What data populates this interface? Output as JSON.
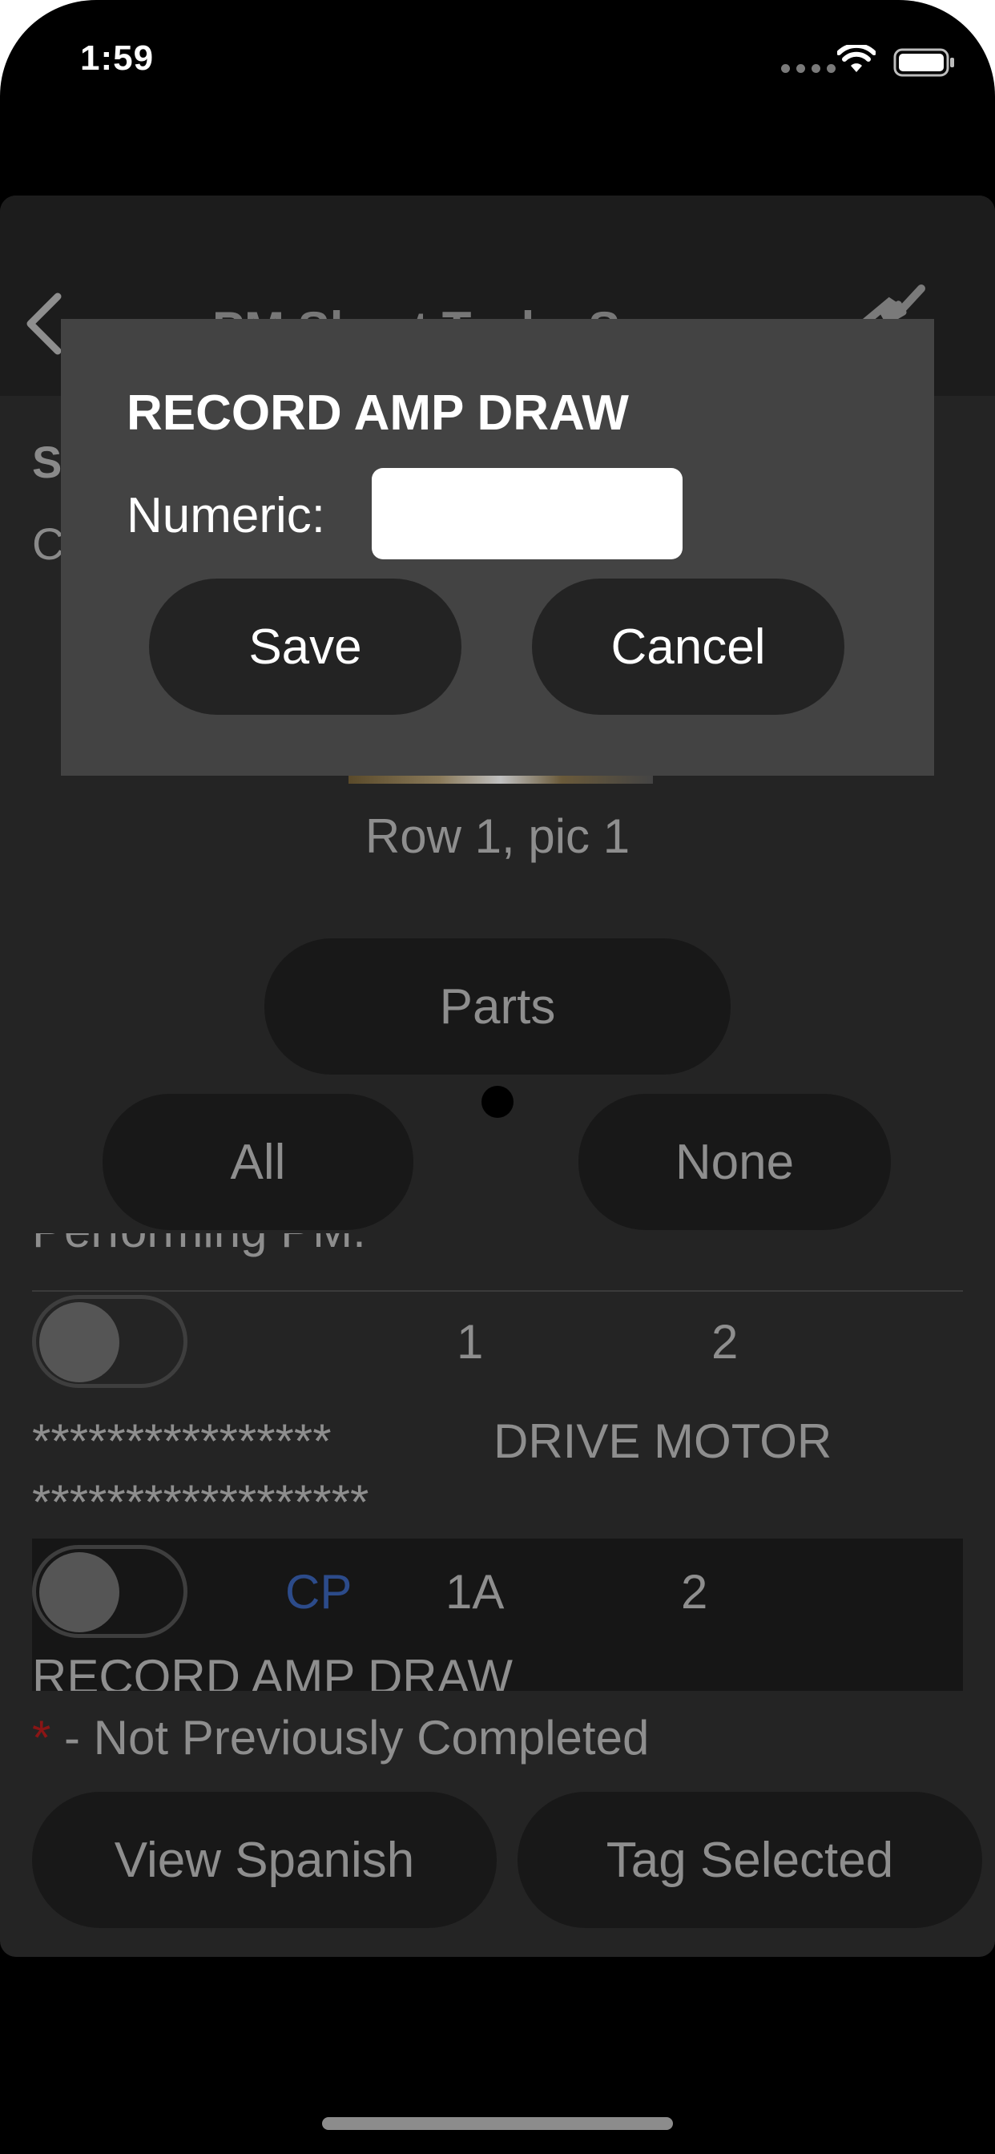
{
  "status": {
    "time": "1:59"
  },
  "nav": {
    "title": "PM Sheet Tasks Sync"
  },
  "header_peek": {
    "line1": "S",
    "line2": "C"
  },
  "image": {
    "caption": "Row 1, pic 1"
  },
  "buttons": {
    "parts": "Parts",
    "all": "All",
    "none": "None"
  },
  "list": {
    "partial_text": "Performing PM.",
    "row1": {
      "col1": "1",
      "col2": "2"
    },
    "section_header": {
      "stars1": "****************",
      "title": "DRIVE MOTOR",
      "stars2": "******************"
    },
    "row2": {
      "tag": "CP",
      "col1": "1A",
      "col2": "2",
      "partial_text": "RECORD AMP DRAW"
    }
  },
  "legend": {
    "star": "*",
    "text": " - Not Previously Completed"
  },
  "footer": {
    "view_spanish": "View Spanish",
    "tag_selected": "Tag Selected"
  },
  "dialog": {
    "title": "RECORD AMP DRAW",
    "label": "Numeric:",
    "input_value": "",
    "save": "Save",
    "cancel": "Cancel"
  },
  "colors": {
    "cp_tag": "#2c4b8a",
    "required_star": "#8a1515",
    "dialog_bg": "#434343"
  }
}
